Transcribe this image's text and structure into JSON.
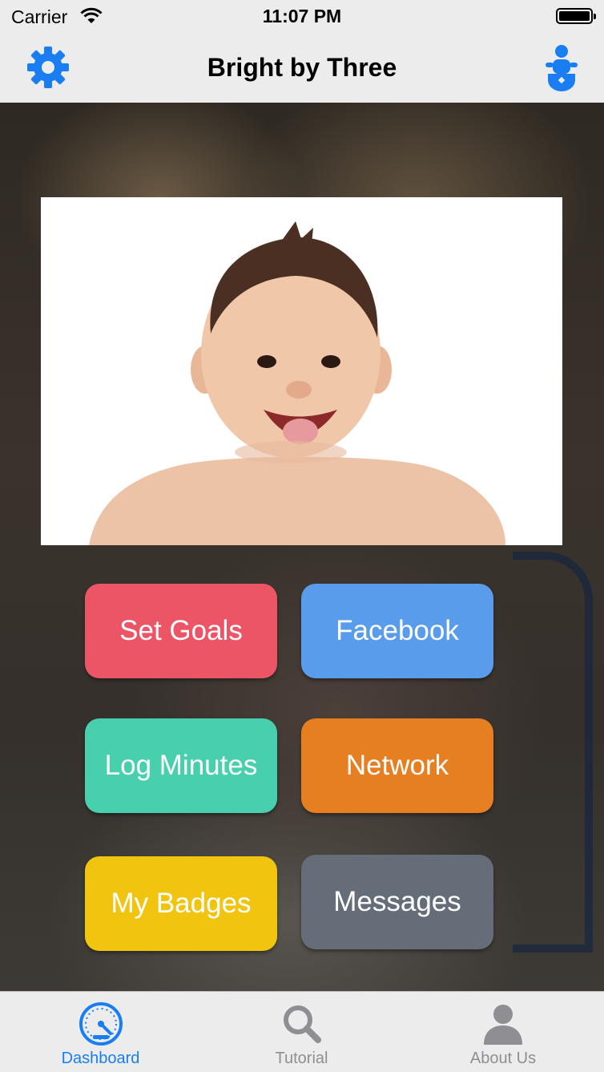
{
  "status_bar": {
    "carrier": "Carrier",
    "time": "11:07 PM"
  },
  "navbar": {
    "title": "Bright by Three",
    "left_icon": "gear-icon",
    "right_icon": "baby-icon",
    "accent_color": "#1a7ef2"
  },
  "tiles": [
    {
      "label": "Set Goals",
      "color": "#ec5566"
    },
    {
      "label": "Facebook",
      "color": "#5a9cec"
    },
    {
      "label": "Log Minutes",
      "color": "#48cfad"
    },
    {
      "label": "Network",
      "color": "#e67e22"
    },
    {
      "label": "My Badges",
      "color": "#f1c40f"
    },
    {
      "label": "Messages",
      "color": "#656d78"
    }
  ],
  "tabbar": {
    "tabs": [
      {
        "label": "Dashboard",
        "icon": "dashboard-gauge-icon",
        "active": true
      },
      {
        "label": "Tutorial",
        "icon": "search-icon",
        "active": false
      },
      {
        "label": "About Us",
        "icon": "person-icon",
        "active": false
      }
    ],
    "active_color": "#1a7ef2",
    "inactive_color": "#8e8e93"
  }
}
